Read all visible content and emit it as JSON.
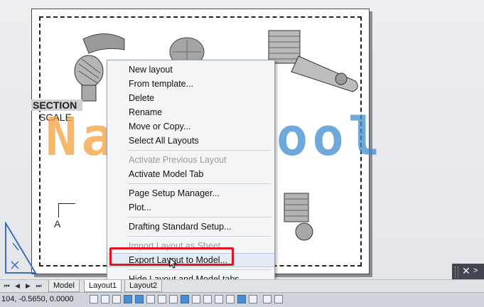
{
  "drawing": {
    "section_label": "SECTION",
    "scale_label": "SCALE",
    "leader_label": "A"
  },
  "watermark": {
    "part1": "Natu",
    "part2": "tool"
  },
  "context_menu": {
    "items": [
      {
        "label": "New layout",
        "disabled": false
      },
      {
        "label": "From template...",
        "disabled": false
      },
      {
        "label": "Delete",
        "disabled": false
      },
      {
        "label": "Rename",
        "disabled": false
      },
      {
        "label": "Move or Copy...",
        "disabled": false
      },
      {
        "label": "Select All Layouts",
        "disabled": false
      },
      {
        "label": "Activate Previous Layout",
        "disabled": true
      },
      {
        "label": "Activate Model Tab",
        "disabled": false
      },
      {
        "label": "Page Setup Manager...",
        "disabled": false
      },
      {
        "label": "Plot...",
        "disabled": false
      },
      {
        "label": "Drafting Standard Setup...",
        "disabled": false
      },
      {
        "label": "Import Layout as Sheet...",
        "disabled": true
      },
      {
        "label": "Export Layout to Model...",
        "disabled": false
      },
      {
        "label": "Hide Layout and Model tabs",
        "disabled": false
      }
    ]
  },
  "tabs": {
    "model": "Model",
    "layout1": "Layout1",
    "layout2": "Layout2"
  },
  "statusbar": {
    "coordinates": "104, -0.5650, 0.0000"
  },
  "colors": {
    "highlight_box": "#e0141c",
    "watermark_orange": "#f2a03c",
    "watermark_blue": "#3e8ccd"
  }
}
